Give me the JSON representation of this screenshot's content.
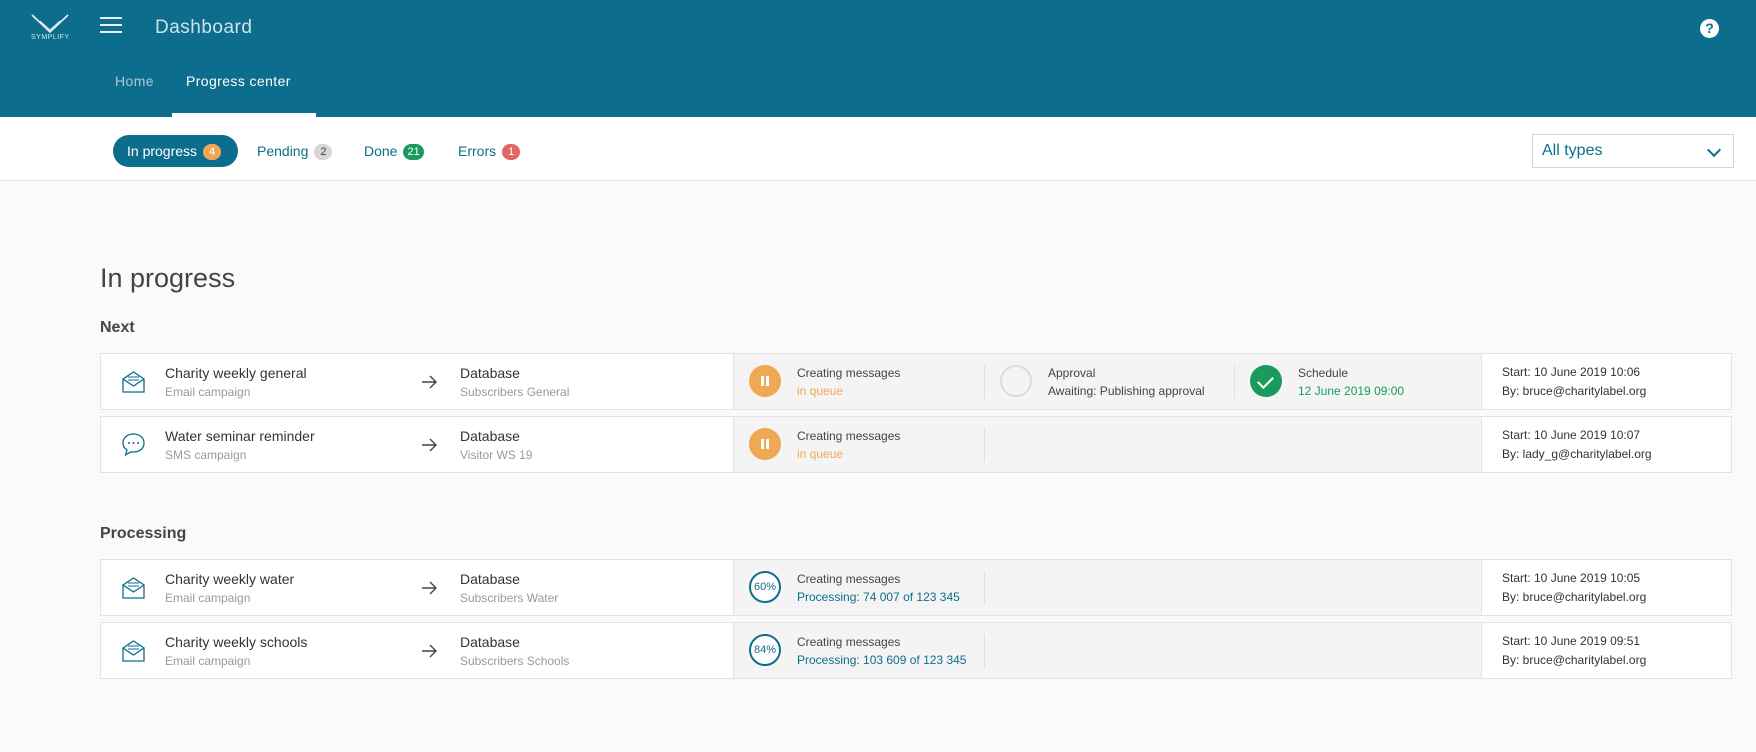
{
  "header": {
    "logo_text": "SYMPLIFY",
    "title": "Dashboard",
    "help_label": "?",
    "nav": {
      "home": "Home",
      "progress_center": "Progress center"
    }
  },
  "filters": {
    "tabs": [
      {
        "label": "In progress",
        "count": "4",
        "active": true,
        "badge_color": "#f0a855"
      },
      {
        "label": "Pending",
        "count": "2",
        "active": false,
        "badge_color": "#d6d6d6"
      },
      {
        "label": "Done",
        "count": "21",
        "active": false,
        "badge_color": "#1a9b5c"
      },
      {
        "label": "Errors",
        "count": "1",
        "active": false,
        "badge_color": "#e06767"
      }
    ],
    "type_select": "All types"
  },
  "main": {
    "title": "In progress",
    "groups": [
      {
        "title": "Next",
        "rows": [
          {
            "icon": "email-envelope-icon",
            "name": "Charity weekly general",
            "type": "Email campaign",
            "db_name": "Database",
            "db_sub": "Subscribers General",
            "steps": [
              {
                "icon": "pause-icon",
                "title": "Creating messages",
                "sub": "in queue"
              },
              {
                "icon": "empty-circle-icon",
                "title": "Approval",
                "sub": "Awaiting: Publishing approval"
              },
              {
                "icon": "check-icon",
                "title": "Schedule",
                "sub": "12 June 2019 09:00"
              }
            ],
            "start": "Start: 10 June 2019 10:06",
            "by": "By: bruce@charitylabel.org"
          },
          {
            "icon": "sms-bubble-icon",
            "name": "Water seminar reminder",
            "type": "SMS campaign",
            "db_name": "Database",
            "db_sub": "Visitor WS 19",
            "steps": [
              {
                "icon": "pause-icon",
                "title": "Creating messages",
                "sub": "in queue"
              }
            ],
            "start": "Start: 10 June 2019 10:07",
            "by": "By: lady_g@charitylabel.org"
          }
        ]
      },
      {
        "title": "Processing",
        "rows": [
          {
            "icon": "email-envelope-icon",
            "name": "Charity weekly water",
            "type": "Email campaign",
            "db_name": "Database",
            "db_sub": "Subscribers Water",
            "steps": [
              {
                "icon": "progress-circle-icon",
                "percent": "60%",
                "title": "Creating messages",
                "sub": "Processing: 74 007 of 123 345"
              }
            ],
            "start": "Start: 10 June 2019 10:05",
            "by": "By: bruce@charitylabel.org"
          },
          {
            "icon": "email-envelope-icon",
            "name": "Charity weekly schools",
            "type": "Email campaign",
            "db_name": "Database",
            "db_sub": "Subscribers Schools",
            "steps": [
              {
                "icon": "progress-circle-icon",
                "percent": "84%",
                "title": "Creating messages",
                "sub": "Processing: 103 609 of 123 345"
              }
            ],
            "start": "Start: 10 June 2019 09:51",
            "by": "By: bruce@charitylabel.org"
          }
        ]
      }
    ]
  },
  "colors": {
    "primary": "#0d6d8c",
    "queue": "#f0a855",
    "success": "#1a9b5c",
    "error": "#e06767"
  }
}
